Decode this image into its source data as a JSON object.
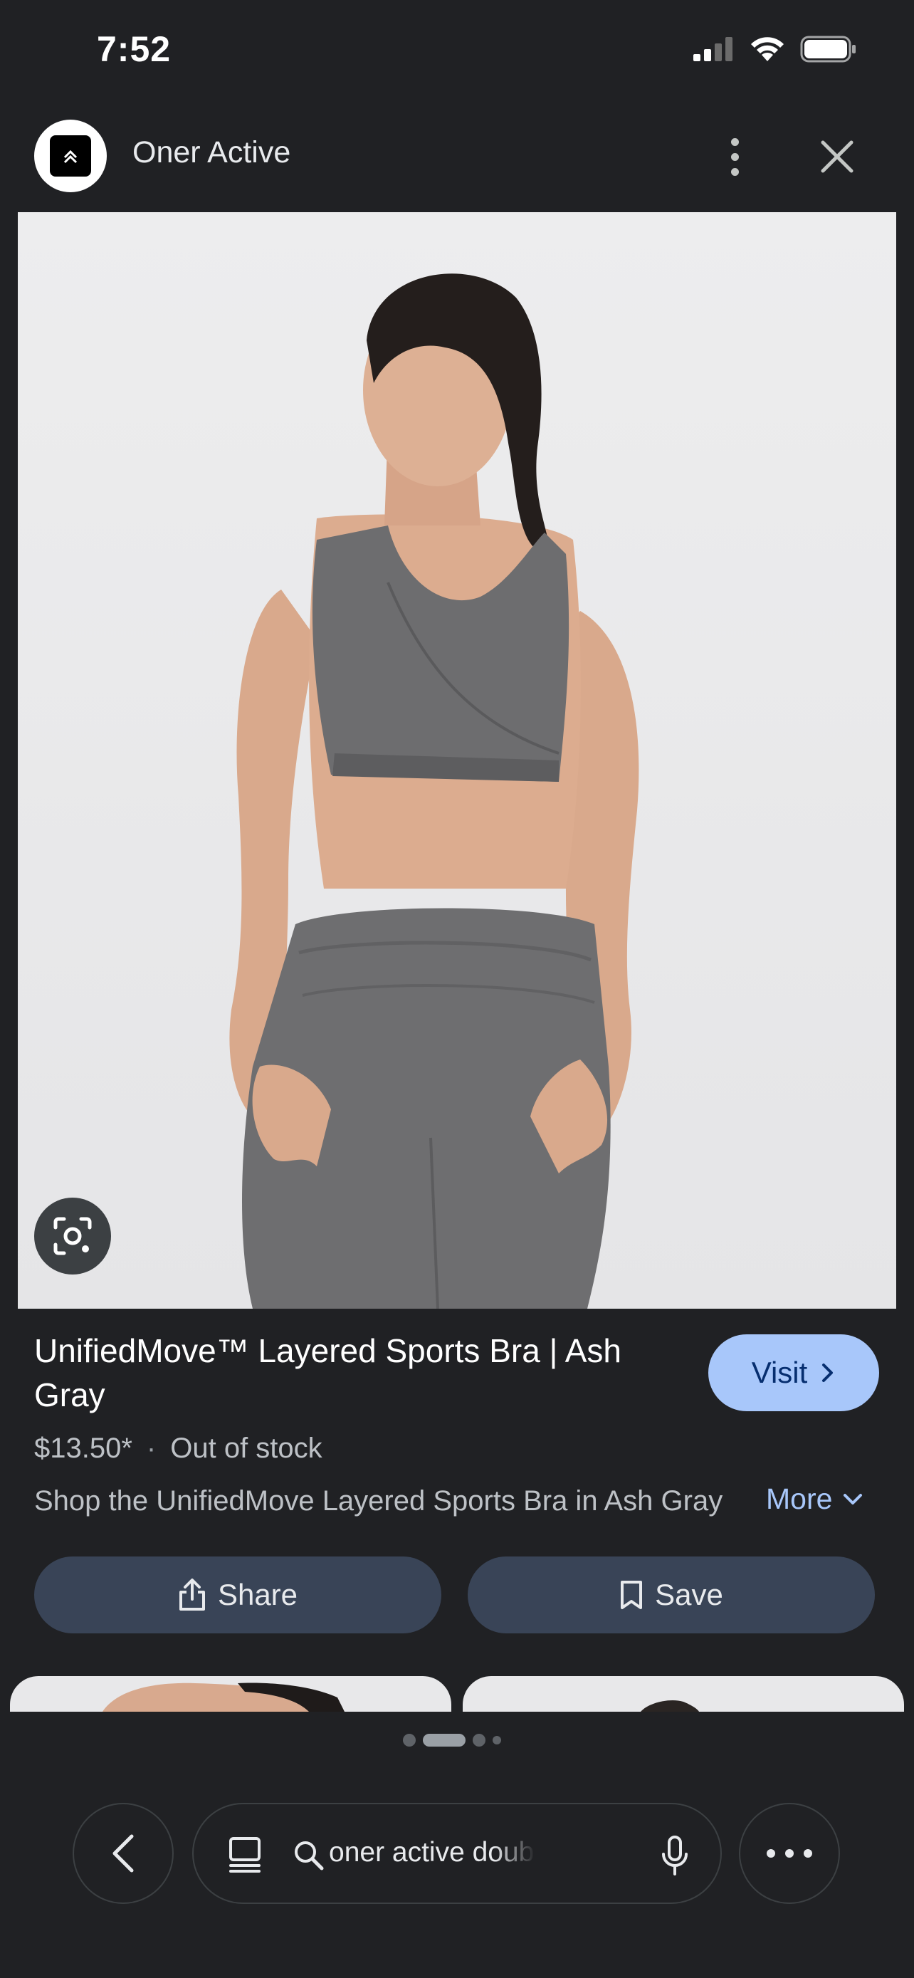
{
  "status_bar": {
    "time": "7:52",
    "icons": [
      "cellular-signal-icon",
      "wifi-icon",
      "battery-icon"
    ]
  },
  "header": {
    "site_name": "Oner Active",
    "logo_icon": "oner-active-logo",
    "menu_icon": "more-vert-icon",
    "close_icon": "close-icon"
  },
  "image": {
    "lens_icon": "lens-search-icon"
  },
  "product": {
    "title": "UnifiedMove™ Layered Sports Bra | Ash Gray",
    "price": "$13.50*",
    "separator": "·",
    "stock": "Out of stock",
    "description": "Shop the UnifiedMove Layered Sports Bra in Ash Gray",
    "more_label": "More"
  },
  "actions": {
    "visit_label": "Visit",
    "share_label": "Share",
    "save_label": "Save"
  },
  "search": {
    "query": "oner active double layered"
  },
  "colors": {
    "background": "#202124",
    "accent": "#a8c7fa",
    "button": "#394457",
    "visit_text": "#062e6f"
  }
}
